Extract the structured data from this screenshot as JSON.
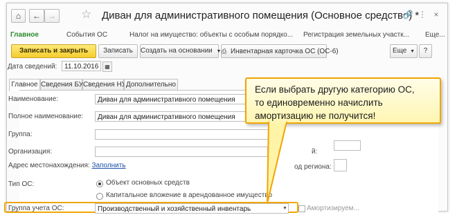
{
  "window": {
    "title": "Диван для административного помещения (Основное средство) *"
  },
  "sections": [
    {
      "label": "Главное",
      "active": true
    },
    {
      "label": "События ОС",
      "active": false
    },
    {
      "label": "Налог на имущество: объекты с особым порядко...",
      "active": false
    },
    {
      "label": "Регистрация земельных участк...",
      "active": false
    },
    {
      "label": "Еще...",
      "active": false
    }
  ],
  "toolbar": {
    "save_close": "Записать и закрыть",
    "save": "Записать",
    "create_based": "Создать на основании",
    "inventory_card": "Инвентарная карточка ОС (ОС-6)",
    "more": "Еще",
    "help": "?"
  },
  "date": {
    "label": "Дата сведений:",
    "value": "11.10.2016"
  },
  "tabs": [
    {
      "label": "Главное",
      "active": true
    },
    {
      "label": "Сведения БУ",
      "active": false
    },
    {
      "label": "Сведения НУ",
      "active": false
    },
    {
      "label": "Дополнительно",
      "active": false
    }
  ],
  "form": {
    "name_label": "Наименование:",
    "name_value": "Диван для административного помещения",
    "fullname_label": "Полное наименование:",
    "fullname_value": "Диван для административного помещения",
    "group_label": "Группа:",
    "group_value": "",
    "org_label": "Организация:",
    "address_label": "Адрес местонахождения:",
    "address_link": "Заполнить",
    "region_label": "Код региона:",
    "type_label": "Тип ОС:",
    "type_option1": "Объект основных средств",
    "type_option2": "Капитальное вложение в арендованное имущество",
    "accounting_group_label": "Группа учета ОС:",
    "accounting_group_value": "Производственный и хозяйственный инвентарь",
    "extra_label": "Амортизируем..."
  },
  "callout": {
    "line1": "Если выбрать другую категорию ОС,",
    "line2": "то единовременно начислить",
    "line3": "амортизацию не получится!"
  },
  "colors": {
    "accent_green": "#2b8a2b",
    "primary_button": "#f4cd2d",
    "callout_border": "#f0a500",
    "callout_bg": "#fff6b3",
    "link": "#1a4fa8"
  }
}
